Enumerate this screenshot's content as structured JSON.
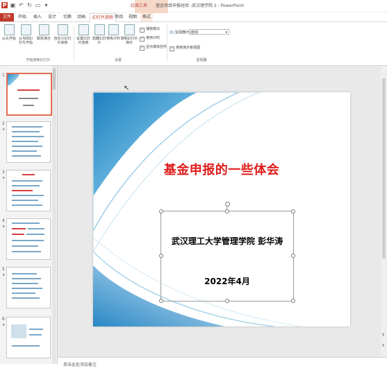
{
  "window": {
    "context_tab_group": "绘图工具",
    "title": "基金项目申报经验 -武汉理学院 2 - PowerPoint"
  },
  "tabs": [
    "文件",
    "开始",
    "插入",
    "设计",
    "切换",
    "动画",
    "幻灯片放映",
    "审阅",
    "视图",
    "格式"
  ],
  "active_tab": "幻灯片放映",
  "ribbon": {
    "start_group": {
      "label": "开始放映幻灯片",
      "buttons": [
        "从头开始",
        "从当前幻灯片开始",
        "联机演示",
        "自定义幻灯片放映"
      ]
    },
    "setup_group": {
      "label": "设置",
      "buttons": [
        "设置幻灯片放映",
        "隐藏幻灯片",
        "排练计时",
        "录制幻灯片演示"
      ],
      "checkboxes": [
        {
          "label": "播放旁白",
          "checked": true
        },
        {
          "label": "使用计时",
          "checked": true
        },
        {
          "label": "显示媒体控件",
          "checked": true
        }
      ]
    },
    "monitor_group": {
      "label": "监视器",
      "monitor_label": "监视器(M):",
      "monitor_value": "自动",
      "presenter_view": "使用演示者视图",
      "presenter_view_checked": true
    }
  },
  "slides_panel": {
    "numbers": [
      "1",
      "2",
      "3",
      "4",
      "5",
      "6",
      "7"
    ],
    "selected": 0
  },
  "slide": {
    "title": "基金申报的一些体会",
    "author": "武汉理工大学管理学院  彭华涛",
    "date": "2022年4月"
  },
  "notes": {
    "placeholder": "单击此处添加备注"
  },
  "colors": {
    "accent": "#c0392b",
    "title_red": "#e01c1c",
    "selected_border": "#e46c50"
  }
}
